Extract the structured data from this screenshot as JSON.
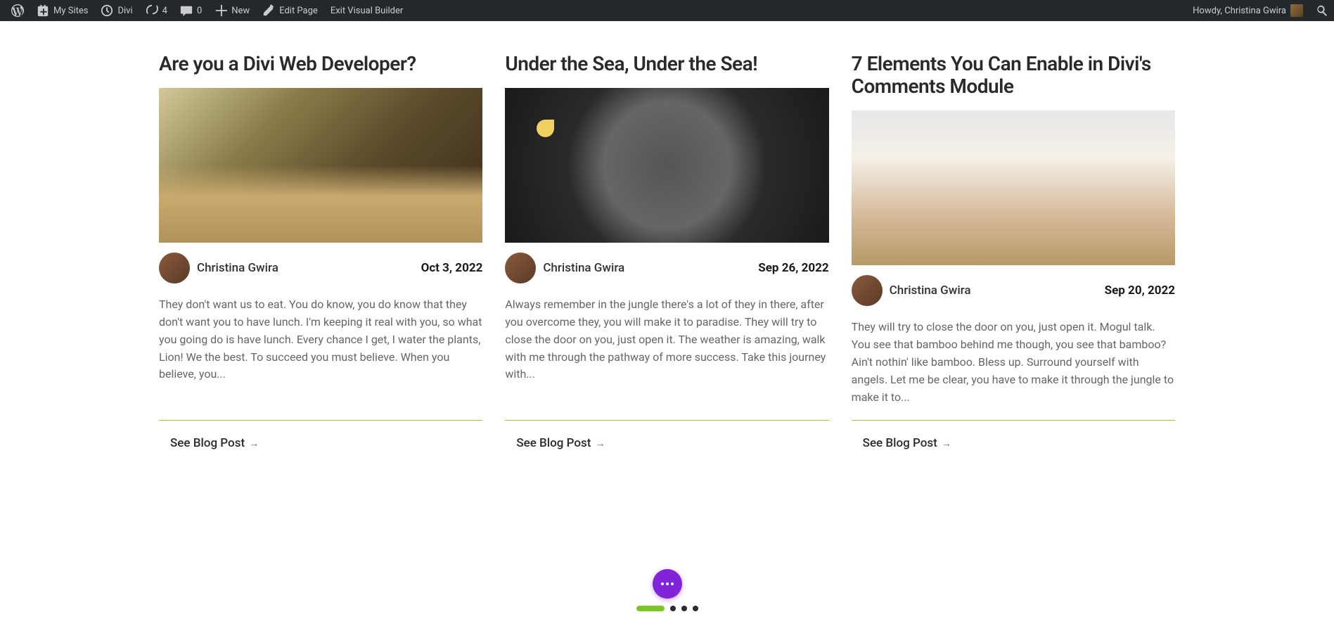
{
  "adminBar": {
    "mySites": "My Sites",
    "siteName": "Divi",
    "updates": "4",
    "comments": "0",
    "new": "New",
    "editPage": "Edit Page",
    "exitVB": "Exit Visual Builder",
    "greeting": "Howdy, Christina Gwira"
  },
  "posts": [
    {
      "title": "Are you a Divi Web Developer?",
      "author": "Christina Gwira",
      "date": "Oct 3, 2022",
      "excerpt": "They don't want us to eat. You do know, you do know that they don't want you to have lunch. I'm keeping it real with you, so what you going do is have lunch. Every chance I get, I water the plants, Lion! We the best. To succeed you must believe. When you believe, you...",
      "readMore": "See Blog Post"
    },
    {
      "title": "Under the Sea, Under the Sea!",
      "author": "Christina Gwira",
      "date": "Sep 26, 2022",
      "excerpt": "Always remember in the jungle there's a lot of they in there, after you overcome they, you will make it to paradise. They will try to close the door on you, just open it. The weather is amazing, walk with me through the pathway of more success. Take this journey with...",
      "readMore": "See Blog Post"
    },
    {
      "title": "7 Elements You Can Enable in Divi's Comments Module",
      "author": "Christina Gwira",
      "date": "Sep 20, 2022",
      "excerpt": "They will try to close the door on you, just open it. Mogul talk. You see that bamboo behind me though, you see that bamboo? Ain't nothin' like bamboo. Bless up. Surround yourself with angels. Let me be clear, you have to make it through the jungle to make it to...",
      "readMore": "See Blog Post"
    }
  ]
}
